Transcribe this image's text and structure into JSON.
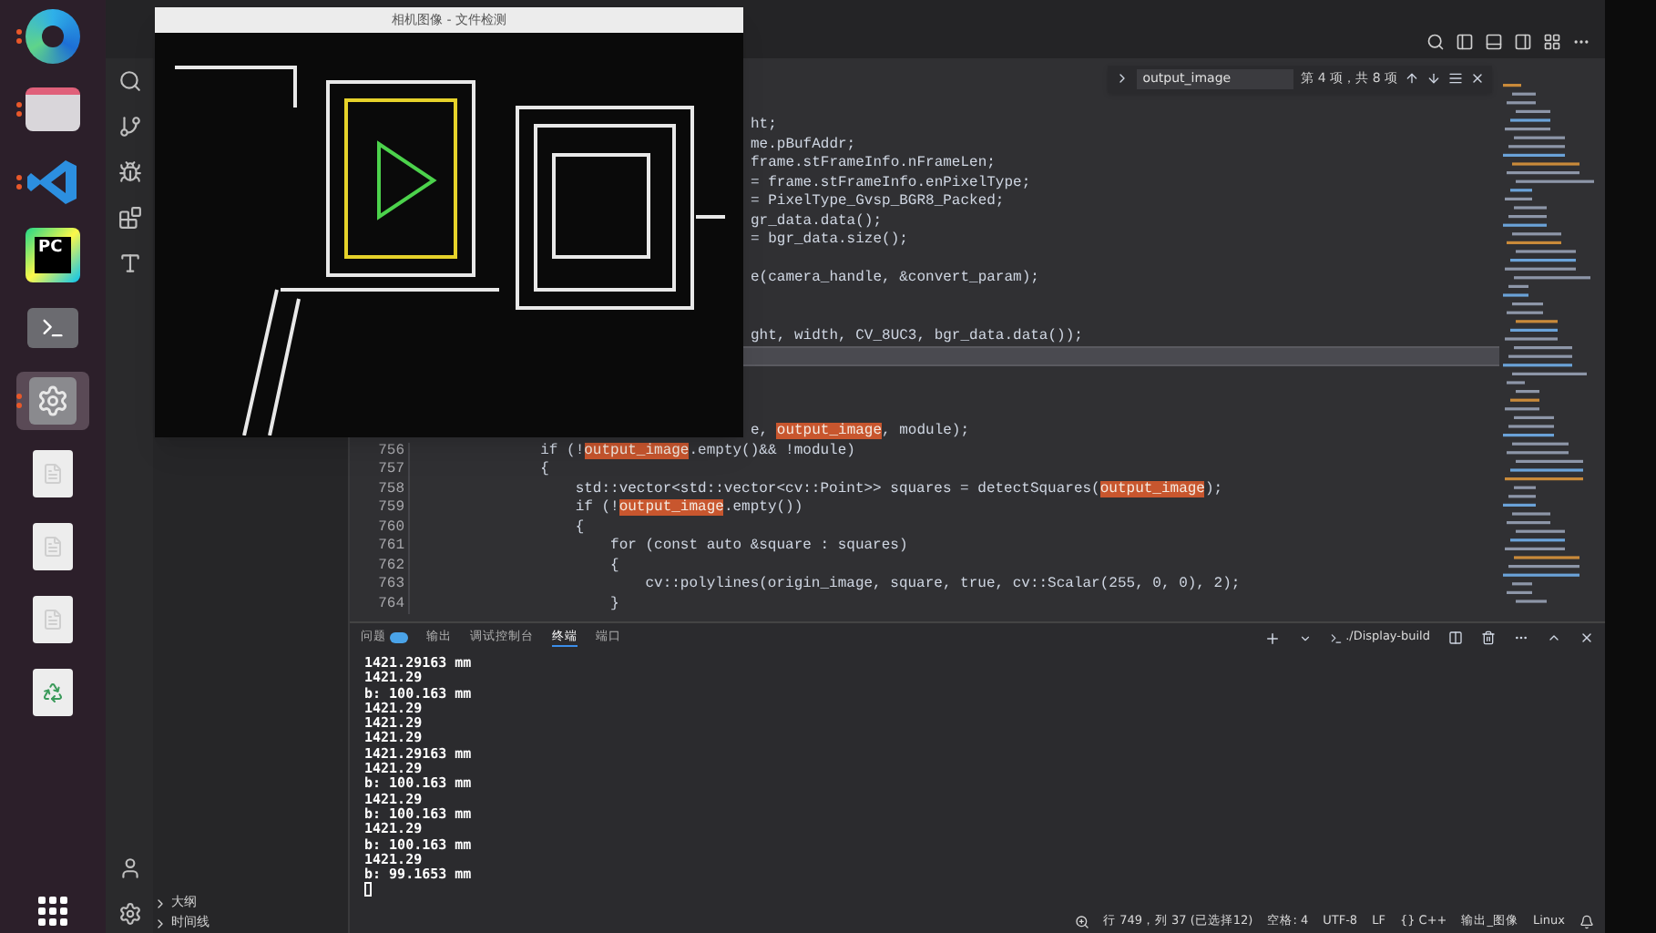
{
  "dock": {
    "items": [
      {
        "running": true,
        "selected": false
      },
      {
        "running": true,
        "selected": false
      },
      {
        "running": true,
        "selected": false
      },
      {
        "running": false,
        "selected": false,
        "label": "PC"
      },
      {
        "running": false,
        "selected": false
      },
      {
        "running": true,
        "selected": true
      },
      {
        "running": false,
        "selected": false
      },
      {
        "running": false,
        "selected": false
      },
      {
        "running": false,
        "selected": false
      },
      {
        "running": false,
        "selected": false
      }
    ]
  },
  "camera_window": {
    "title": "相机图像 - 文件检测"
  },
  "find_widget": {
    "value": "output_image",
    "result": "第 4 项，共 8 项"
  },
  "code": {
    "fragment_rows": [
      {
        "current": false,
        "segments": [
          {
            "text": "ht;",
            "match": false
          }
        ]
      },
      {
        "current": false,
        "segments": [
          {
            "text": "me.pBufAddr;",
            "match": false
          }
        ]
      },
      {
        "current": false,
        "segments": [
          {
            "text": "frame.stFrameInfo.nFrameLen;",
            "match": false
          }
        ]
      },
      {
        "current": false,
        "segments": [
          {
            "text": "= frame.stFrameInfo.enPixelType;",
            "match": false
          }
        ]
      },
      {
        "current": false,
        "segments": [
          {
            "text": "= PixelType_Gvsp_BGR8_Packed;",
            "match": false
          }
        ]
      },
      {
        "current": false,
        "segments": [
          {
            "text": "gr_data.data();",
            "match": false
          }
        ]
      },
      {
        "current": false,
        "segments": [
          {
            "text": "= bgr_data.size();",
            "match": false
          }
        ]
      },
      {
        "current": false
      },
      {
        "current": false,
        "segments": [
          {
            "text": "e(camera_handle, &convert_param);",
            "match": false
          }
        ]
      },
      {
        "current": false
      },
      {
        "current": false
      },
      {
        "current": false,
        "segments": [
          {
            "text": "ght, width, CV_8UC3, bgr_data.data());",
            "match": false
          }
        ]
      },
      {
        "current": true
      },
      {
        "current": false
      },
      {
        "current": false
      },
      {
        "current": false
      },
      {
        "current": false,
        "segments": [
          {
            "text": "e, ",
            "match": false
          },
          {
            "text": "output_image",
            "match": true
          },
          {
            "text": ", module);",
            "match": false
          }
        ]
      }
    ],
    "lines": [
      {
        "number": "756",
        "segments": [
          {
            "text": "            if (!",
            "match": false
          },
          {
            "text": "output_image",
            "match": true
          },
          {
            "text": ".empty()&& !module)",
            "match": false
          }
        ]
      },
      {
        "number": "757",
        "segments": [
          {
            "text": "            {",
            "match": false
          }
        ]
      },
      {
        "number": "758",
        "segments": [
          {
            "text": "                std::vector<std::vector<cv::Point>> squares = detectSquares(",
            "match": false
          },
          {
            "text": "output_image",
            "match": true
          },
          {
            "text": ");",
            "match": false
          }
        ]
      },
      {
        "number": "759",
        "segments": [
          {
            "text": "                if (!",
            "match": false
          },
          {
            "text": "output_image",
            "match": true
          },
          {
            "text": ".empty())",
            "match": false
          }
        ]
      },
      {
        "number": "760",
        "segments": [
          {
            "text": "                {",
            "match": false
          }
        ]
      },
      {
        "number": "761",
        "segments": [
          {
            "text": "                    for (const auto &square : squares)",
            "match": false
          }
        ]
      },
      {
        "number": "762",
        "segments": [
          {
            "text": "                    {",
            "match": false
          }
        ]
      },
      {
        "number": "763",
        "segments": [
          {
            "text": "                        cv::polylines(origin_image, square, true, cv::Scalar(255, 0, 0), 2);",
            "match": false
          }
        ]
      },
      {
        "number": "764",
        "segments": [
          {
            "text": "                    }",
            "match": false
          }
        ]
      }
    ]
  },
  "panel": {
    "tabs": [
      {
        "label": "问题",
        "selected": false,
        "badge": true
      },
      {
        "label": "输出",
        "selected": false,
        "badge": false
      },
      {
        "label": "调试控制台",
        "selected": false,
        "badge": false
      },
      {
        "label": "终端",
        "selected": true,
        "badge": false
      },
      {
        "label": "端口",
        "selected": false,
        "badge": false
      }
    ],
    "terminal_name": "./Display-build",
    "terminal_lines": [
      "1421.29163 mm",
      "1421.29",
      "b: 100.163 mm",
      "1421.29",
      "1421.29",
      "1421.29",
      "1421.29163 mm",
      "1421.29",
      "b: 100.163 mm",
      "1421.29",
      "b: 100.163 mm",
      "1421.29",
      "b: 100.163 mm",
      "1421.29",
      "b: 99.1653 mm"
    ]
  },
  "sidebar": {
    "sections": [
      "大纲",
      "时间线"
    ]
  },
  "status_bar": {
    "items": [
      "行 749，列 37 (已选择12)",
      "空格: 4",
      "UTF-8",
      "LF",
      "{} C++",
      "输出_图像",
      "Linux"
    ]
  }
}
